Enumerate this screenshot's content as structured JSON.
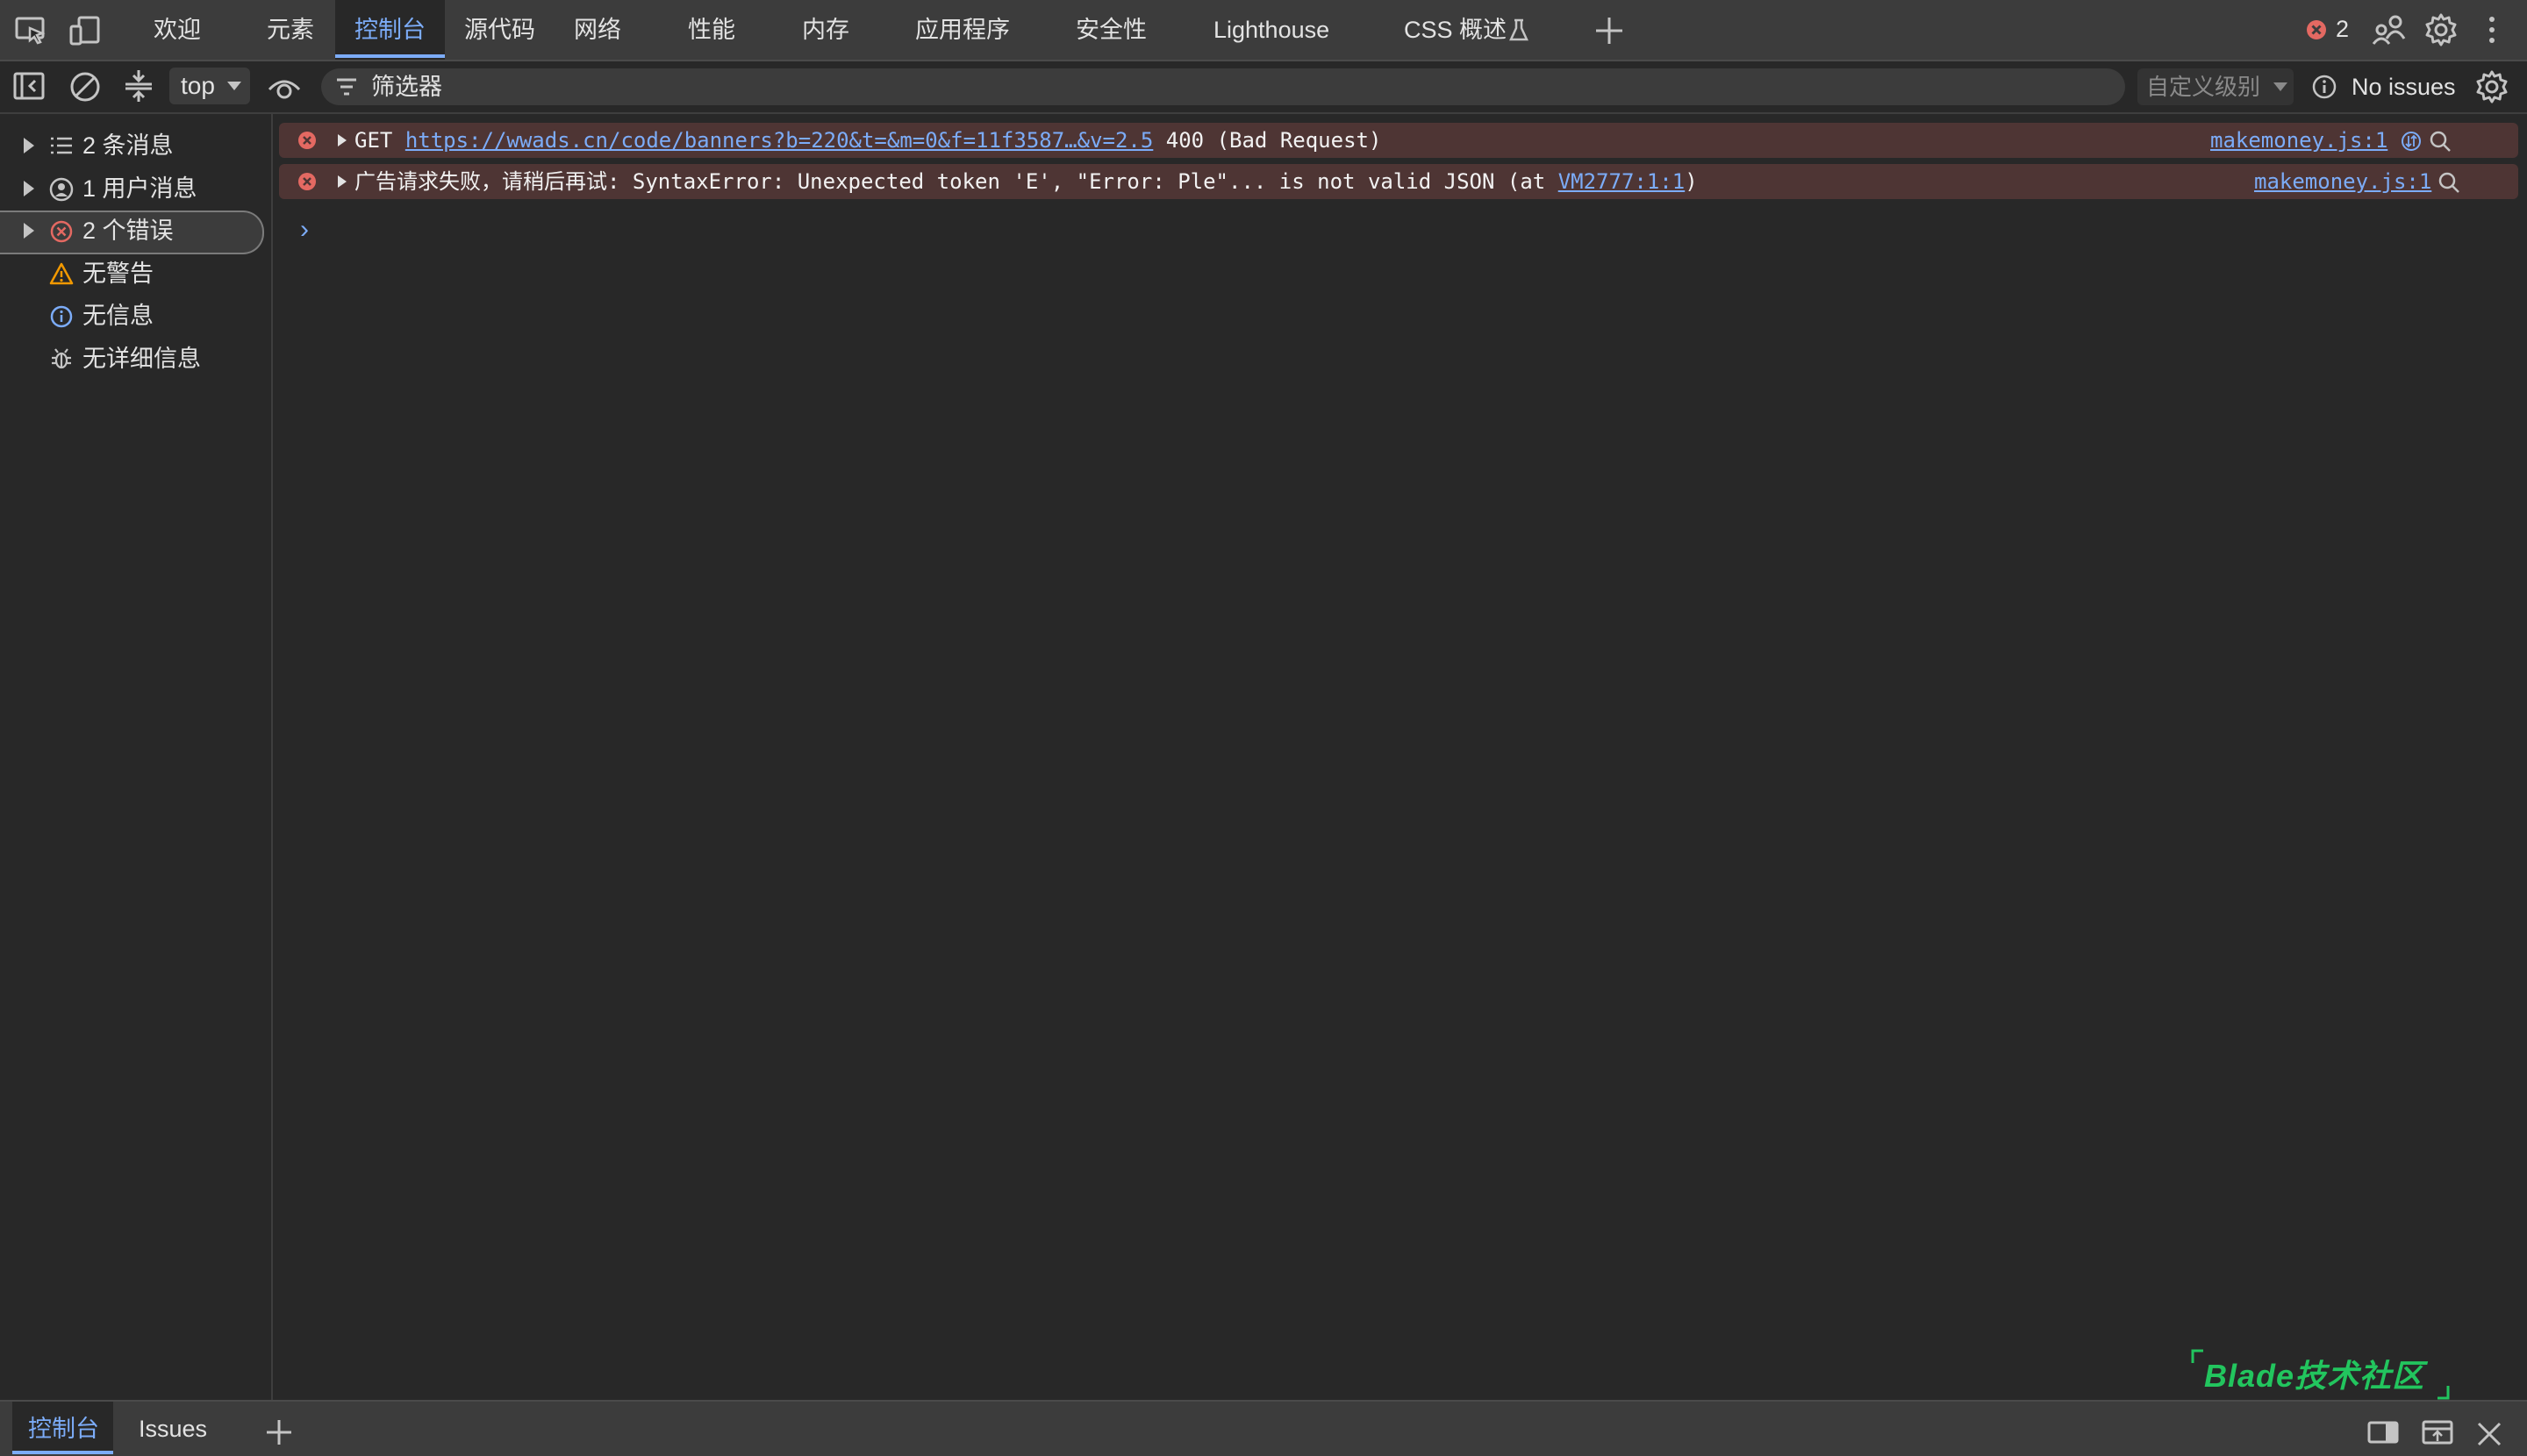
{
  "top_tabs": [
    {
      "label": "欢迎"
    },
    {
      "label": "元素"
    },
    {
      "label": "控制台",
      "active": true
    },
    {
      "label": "源代码"
    },
    {
      "label": "网络"
    },
    {
      "label": "性能"
    },
    {
      "label": "内存"
    },
    {
      "label": "应用程序"
    },
    {
      "label": "安全性"
    },
    {
      "label": "Lighthouse"
    },
    {
      "label": "CSS 概述"
    }
  ],
  "header_right": {
    "error_count": "2"
  },
  "toolbar": {
    "context": "top",
    "filter_placeholder": "筛选器",
    "levels_label": "自定义级别",
    "issues_label": "No issues"
  },
  "sidebar": {
    "items": [
      {
        "label": "2 条消息",
        "icon": "list-icon"
      },
      {
        "label": "1 用户消息",
        "icon": "user-icon"
      },
      {
        "label": "2 个错误",
        "icon": "error-icon",
        "selected": true
      },
      {
        "label": "无警告",
        "icon": "warning-icon"
      },
      {
        "label": "无信息",
        "icon": "info-icon"
      },
      {
        "label": "无详细信息",
        "icon": "bug-icon"
      }
    ]
  },
  "console": {
    "messages": [
      {
        "level": "error",
        "method": "GET",
        "url": "https://wwads.cn/code/banners?b=220&t=&m=0&f=11f3587…&v=2.5",
        "status": "400 (Bad Request)",
        "source": "makemoney.js:1"
      },
      {
        "level": "error",
        "text": "广告请求失败，请稍后再试: SyntaxError: Unexpected token 'E', \"Error: Ple\"... is not valid JSON (at ",
        "link": "VM2777:1:1",
        "text_end": ")",
        "source": "makemoney.js:1"
      }
    ],
    "prompt": "›"
  },
  "drawer": {
    "tabs": [
      {
        "label": "控制台",
        "active": true
      },
      {
        "label": "Issues"
      }
    ]
  },
  "watermark": {
    "text": "Blade技术社区"
  },
  "colors": {
    "accent": "#7cacf8",
    "error": "#e46962",
    "error_row_bg": "#4e3534",
    "warning": "#f29900",
    "watermark": "#22c55e"
  }
}
